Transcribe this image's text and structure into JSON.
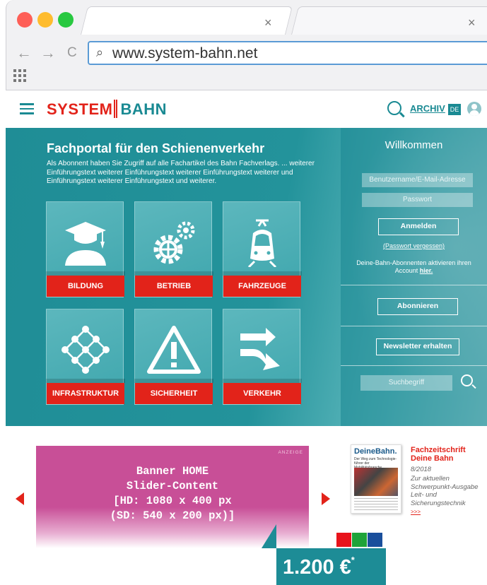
{
  "browser": {
    "tab_close": "×",
    "back": "←",
    "forward": "→",
    "reload": "C",
    "url": "www.system-bahn.net",
    "traffic_colors": [
      "#fe5f57",
      "#febc2e",
      "#28c840"
    ]
  },
  "header": {
    "logo_left": "SYSTEM",
    "logo_right": "BAHN",
    "archive": "ARCHIV",
    "language": "DE",
    "icons": [
      "hamburger-icon",
      "search-icon",
      "user-icon"
    ]
  },
  "hero": {
    "title": "Fachportal für den Schienenverkehr",
    "intro": "Als Abonnent haben Sie Zugriff auf alle Fachartikel des Bahn Fachverlags. ... weiterer Einführungstext weiterer Einführungstext weiterer Einführungstext weiterer und Einführungstext weiterer Einführungstext und weiterer.",
    "tiles": [
      {
        "label": "BILDUNG",
        "icon": "graduate-icon"
      },
      {
        "label": "BETRIEB",
        "icon": "gears-icon"
      },
      {
        "label": "FAHRZEUGE",
        "icon": "train-icon"
      },
      {
        "label": "INFRASTRUKTUR",
        "icon": "network-icon"
      },
      {
        "label": "SICHERHEIT",
        "icon": "warning-icon"
      },
      {
        "label": "VERKEHR",
        "icon": "merge-arrows-icon"
      }
    ]
  },
  "login": {
    "welcome": "Willkommen",
    "username_placeholder": "Benutzername/E-Mail-Adresse",
    "password_placeholder": "Passwort",
    "login_button": "Anmelden",
    "forgot": "(Passwort vergessen)",
    "activate_text": "Deine-Bahn-Abonnenten aktivieren ihren Account",
    "activate_link": "hier.",
    "subscribe_button": "Abonnieren",
    "newsletter_button": "Newsletter erhalten",
    "search_placeholder": "Suchbegriff"
  },
  "banner": {
    "tag": "ANZEIGE",
    "text": "Banner HOME\nSlider-Content\n[HD: 1080 x 400 px\n(SD: 540 x 200 px)]"
  },
  "magazine": {
    "cover_title": "DeineBahn.",
    "cover_subtitle": "Der Weg zum Technologie-führer der Mobilitätsbranche",
    "title": "Fachzeitschrift\nDeine Bahn",
    "date": "8/2018",
    "description": "Zur aktuellen Schwerpunkt-Ausgabe Leit- und Sicherungstechnik",
    "more": ">>>"
  },
  "swatches": [
    "#e8131b",
    "#1fa33a",
    "#1a4f9c"
  ],
  "price": {
    "value": "1.200 €",
    "mark": "*"
  }
}
